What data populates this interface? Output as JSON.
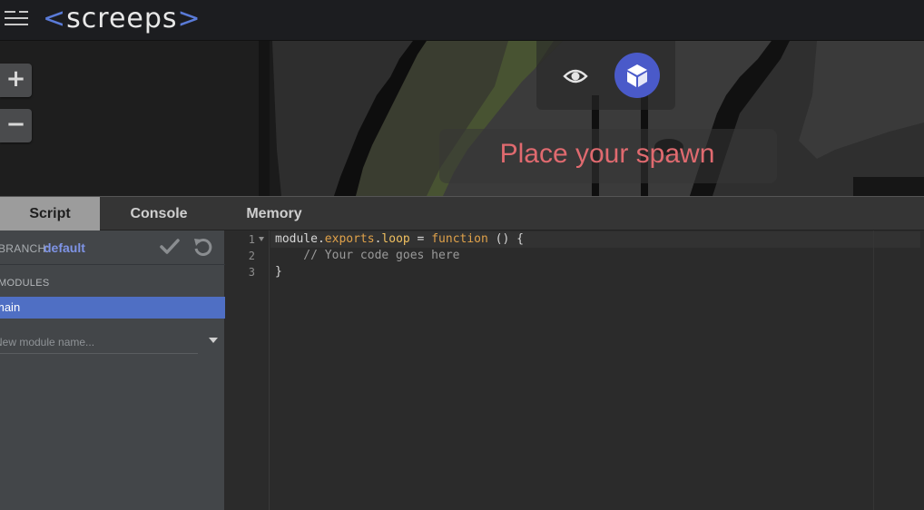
{
  "app": {
    "logo_text": "screeps",
    "logo_open": "<",
    "logo_close": ">"
  },
  "world": {
    "zoom_in_label": "+",
    "zoom_out_label": "−",
    "spawn_message": "Place your spawn",
    "colors": {
      "cube_button": "#4a5ac9",
      "spawn_text": "#e06a6f"
    }
  },
  "tabs": [
    {
      "label": "Script",
      "active": true
    },
    {
      "label": "Console",
      "active": false
    },
    {
      "label": "Memory",
      "active": false
    }
  ],
  "sidebar": {
    "branch_label": "BRANCH:",
    "branch_value": "default",
    "modules_label": "MODULES",
    "modules": [
      {
        "name": "main",
        "selected": true
      }
    ],
    "new_module_placeholder": "New module name...",
    "icons": [
      "check-icon",
      "undo-icon",
      "caret-down-icon"
    ]
  },
  "editor": {
    "line_numbers": [
      "1",
      "2",
      "3"
    ],
    "code": {
      "l1": {
        "a": "module",
        "b": ".",
        "c": "exports",
        "d": ".",
        "e": "loop",
        "f": " = ",
        "g": "function",
        "h": " () {"
      },
      "l2": "    // Your code goes here",
      "l3": "}"
    }
  }
}
